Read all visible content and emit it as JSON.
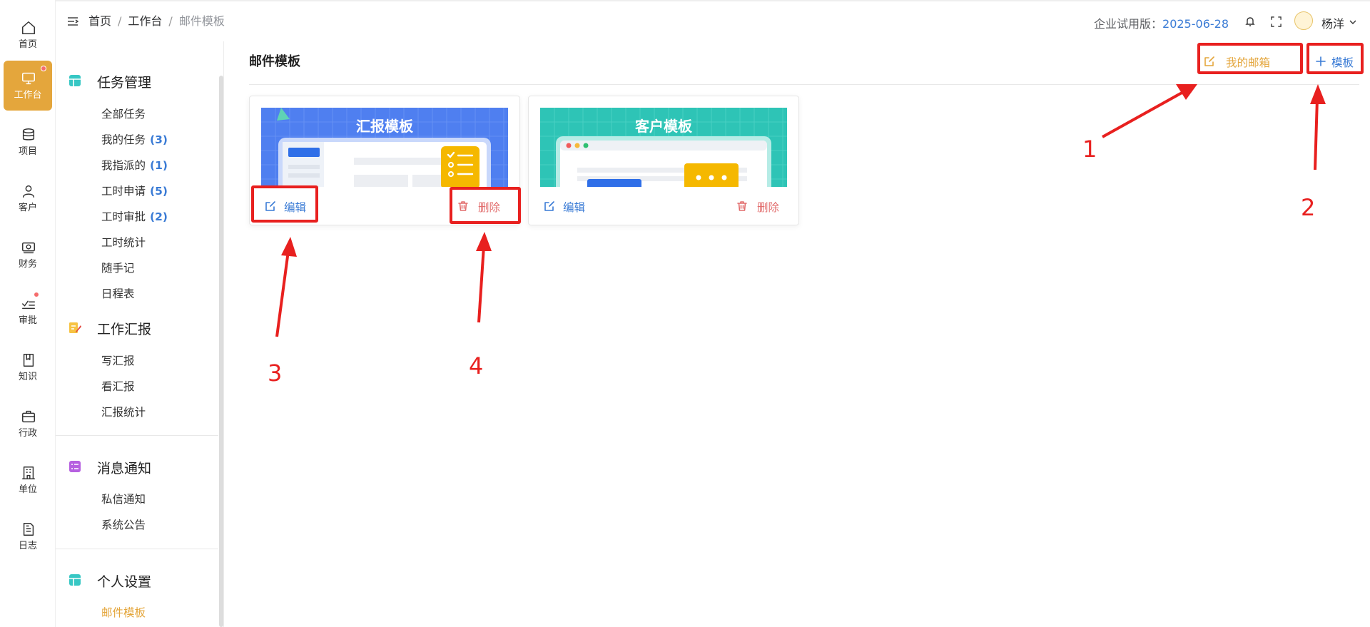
{
  "rail": {
    "items": [
      {
        "label": "首页",
        "icon": "home-icon"
      },
      {
        "label": "工作台",
        "icon": "monitor-icon",
        "active": true,
        "badge": true
      },
      {
        "label": "项目",
        "icon": "database-icon"
      },
      {
        "label": "客户",
        "icon": "user-icon"
      },
      {
        "label": "财务",
        "icon": "money-icon"
      },
      {
        "label": "审批",
        "icon": "checklist-icon",
        "badge": true
      },
      {
        "label": "知识",
        "icon": "book-icon"
      },
      {
        "label": "行政",
        "icon": "briefcase-icon"
      },
      {
        "label": "单位",
        "icon": "building-icon"
      },
      {
        "label": "日志",
        "icon": "document-icon"
      }
    ],
    "active_color": "#e4a63c",
    "badge_color": "#f56c6c"
  },
  "topbar": {
    "breadcrumb": [
      "首页",
      "工作台",
      "邮件模板"
    ],
    "separator": "/",
    "trial_label": "企业试用版：",
    "trial_date": "2025-06-28",
    "username": "杨洋"
  },
  "subnav": {
    "groups": [
      {
        "title": "任务管理",
        "icon": "grid-icon",
        "items": [
          {
            "label": "全部任务",
            "count": ""
          },
          {
            "label": "我的任务",
            "count": "(3)"
          },
          {
            "label": "我指派的",
            "count": "(1)"
          },
          {
            "label": "工时申请",
            "count": "(5)"
          },
          {
            "label": "工时审批",
            "count": "(2)"
          },
          {
            "label": "工时统计",
            "count": ""
          },
          {
            "label": "随手记",
            "count": ""
          },
          {
            "label": "日程表",
            "count": ""
          }
        ]
      },
      {
        "title": "工作汇报",
        "icon": "notepad-pen-icon",
        "items": [
          {
            "label": "写汇报"
          },
          {
            "label": "看汇报"
          },
          {
            "label": "汇报统计"
          }
        ]
      },
      {
        "title": "消息通知",
        "icon": "message-list-icon",
        "items": [
          {
            "label": "私信通知"
          },
          {
            "label": "系统公告"
          }
        ]
      },
      {
        "title": "个人设置",
        "icon": "settings-grid-icon",
        "items": [
          {
            "label": "邮件模板",
            "active": true
          }
        ]
      }
    ]
  },
  "main": {
    "title": "邮件模板",
    "mailbox_button": "我的邮箱",
    "add_button": "模板",
    "cards": [
      {
        "name": "汇报模板",
        "edit": "编辑",
        "delete": "删除",
        "theme": "#4f7ff0"
      },
      {
        "name": "客户模板",
        "edit": "编辑",
        "delete": "删除",
        "theme": "#2ec4b6"
      }
    ]
  },
  "annotations": [
    "1",
    "2",
    "3",
    "4"
  ],
  "colors": {
    "accent": "#e4a63c",
    "link": "#3a7bd5",
    "danger": "#e26d6d",
    "annotation": "#e8201f"
  }
}
